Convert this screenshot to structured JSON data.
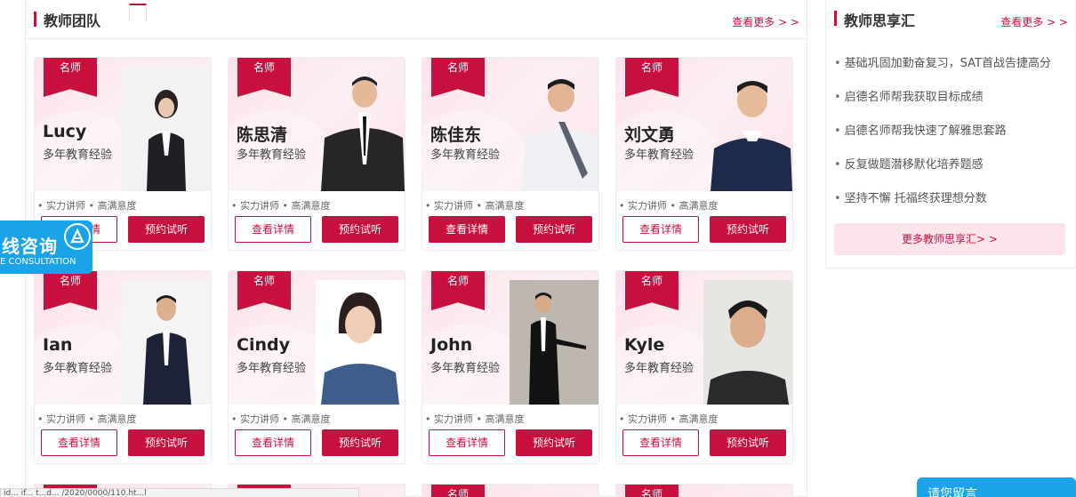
{
  "main": {
    "title": "教师团队",
    "more_label": "查看更多 > >",
    "button_detail": "查看详情",
    "button_trial": "预约试听",
    "ribbon_label": "名师",
    "teachers": [
      {
        "name": "Lucy",
        "desc": "多年教育经验",
        "tags": "• 实力讲师 • 高满意度"
      },
      {
        "name": "陈思清",
        "desc": "多年教育经验",
        "tags": "• 实力讲师 • 高满意度"
      },
      {
        "name": "陈佳东",
        "desc": "多年教育经验",
        "tags": "• 实力讲师 • 高满意度"
      },
      {
        "name": "刘文勇",
        "desc": "多年教育经验",
        "tags": "• 实力讲师 • 高满意度"
      },
      {
        "name": "Ian",
        "desc": "多年教育经验",
        "tags": "• 实力讲师 • 高满意度"
      },
      {
        "name": "Cindy",
        "desc": "多年教育经验",
        "tags": "• 实力讲师 • 高满意度"
      },
      {
        "name": "John",
        "desc": "多年教育经验",
        "tags": "• 实力讲师 • 高满意度"
      },
      {
        "name": "Kyle",
        "desc": "多年教育经验",
        "tags": "• 实力讲师 • 高满意度"
      }
    ]
  },
  "side": {
    "title": "教师思享汇",
    "more_label": "查看更多 > >",
    "items": [
      "基础巩固加勤奋复习，SAT首战告捷高分",
      "启德名师帮我获取目标成绩",
      "启德名师帮我快速了解雅思套路",
      "反复做题潜移默化培养题感",
      "坚持不懈 托福终获理想分数"
    ],
    "more_button": "更多教师思享汇> >"
  },
  "consult": {
    "main": "线咨询",
    "sub": "E CONSULTATION"
  },
  "status_url": "id... if... t...d...  /2020/0000/110.ht...l",
  "leave_message": "请您留言",
  "colors": {
    "brand": "#c8103e",
    "card_bg": "#fde3ea",
    "consult_blue": "#1aa3e8"
  }
}
